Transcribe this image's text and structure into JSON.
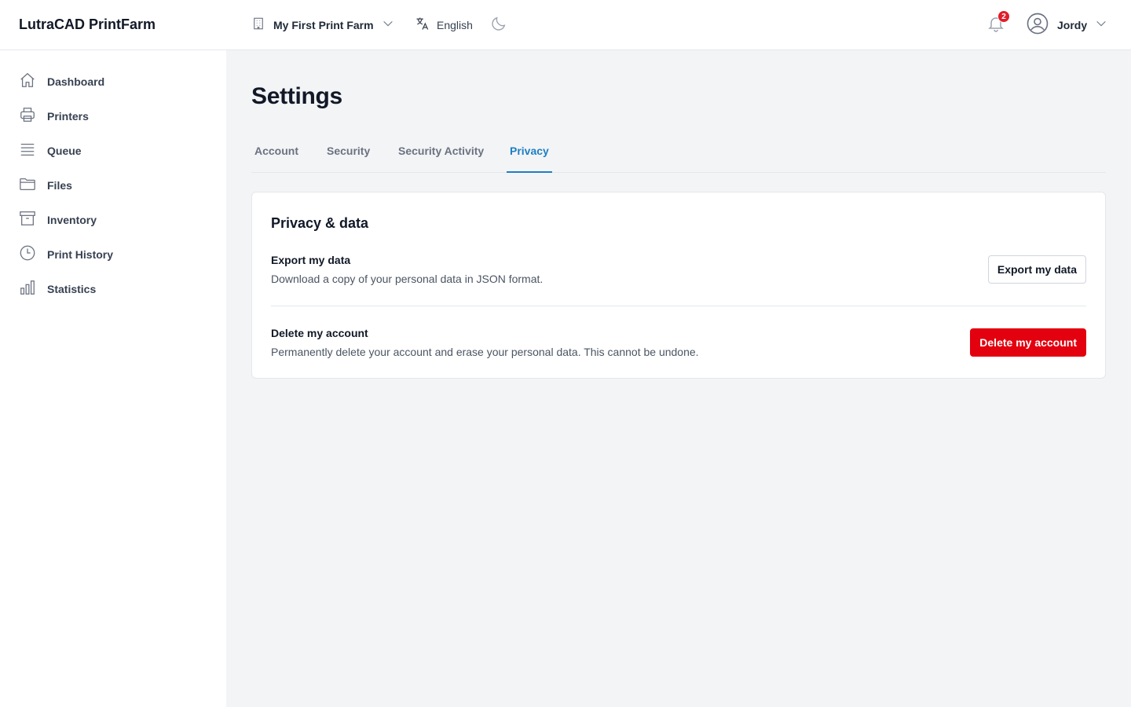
{
  "app": {
    "brand": "LutraCAD PrintFarm"
  },
  "topbar": {
    "farm": {
      "label": "My First Print Farm",
      "icon": "building-icon"
    },
    "language": {
      "label": "English",
      "icon": "translate-icon"
    },
    "theme_icon": "moon-icon",
    "notifications": {
      "count": "2",
      "icon": "bell-icon"
    },
    "user": {
      "name": "Jordy",
      "icon": "user-circle-icon"
    }
  },
  "sidebar": {
    "items": [
      {
        "label": "Dashboard",
        "icon": "home-icon"
      },
      {
        "label": "Printers",
        "icon": "printer-icon"
      },
      {
        "label": "Queue",
        "icon": "queue-icon"
      },
      {
        "label": "Files",
        "icon": "folder-icon"
      },
      {
        "label": "Inventory",
        "icon": "archive-box-icon"
      },
      {
        "label": "Print History",
        "icon": "clock-icon"
      },
      {
        "label": "Statistics",
        "icon": "bar-chart-icon"
      }
    ]
  },
  "page": {
    "title": "Settings",
    "tabs": [
      {
        "label": "Account",
        "active": false
      },
      {
        "label": "Security",
        "active": false
      },
      {
        "label": "Security Activity",
        "active": false
      },
      {
        "label": "Privacy",
        "active": true
      }
    ]
  },
  "privacy": {
    "card_title": "Privacy & data",
    "export": {
      "title": "Export my data",
      "description": "Download a copy of your personal data in JSON format.",
      "button": "Export my data"
    },
    "delete": {
      "title": "Delete my account",
      "description": "Permanently delete your account and erase your personal data. This cannot be undone.",
      "button": "Delete my account"
    }
  },
  "colors": {
    "accent": "#1d7fc4",
    "danger": "#e3000f",
    "badge": "#e11d2a",
    "background": "#f3f4f6"
  }
}
